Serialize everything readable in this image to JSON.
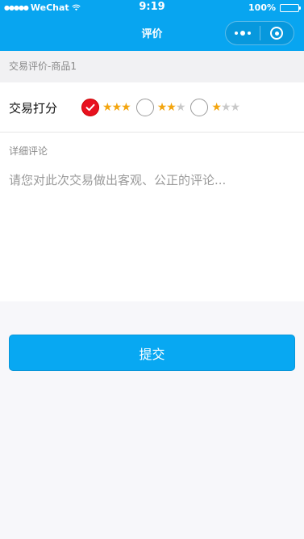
{
  "status_bar": {
    "signal": "●●●●●",
    "carrier": "WeChat",
    "time": "9:19",
    "battery": "100%"
  },
  "nav": {
    "title": "评价",
    "more_icon": "more-dots-icon",
    "close_icon": "target-close-icon"
  },
  "section_header": "交易评价-商品1",
  "rating": {
    "label": "交易打分",
    "selected_index": 0,
    "options": [
      {
        "stars": 3,
        "total": 3,
        "checked": true
      },
      {
        "stars": 2,
        "total": 3,
        "checked": false
      },
      {
        "stars": 1,
        "total": 3,
        "checked": false
      }
    ]
  },
  "comment": {
    "label": "详细评论",
    "placeholder": "请您对此次交易做出客观、公正的评论..."
  },
  "submit_label": "提交",
  "colors": {
    "brand": "#08a5f0",
    "star": "#f3a50f",
    "checked": "#e8111f"
  }
}
